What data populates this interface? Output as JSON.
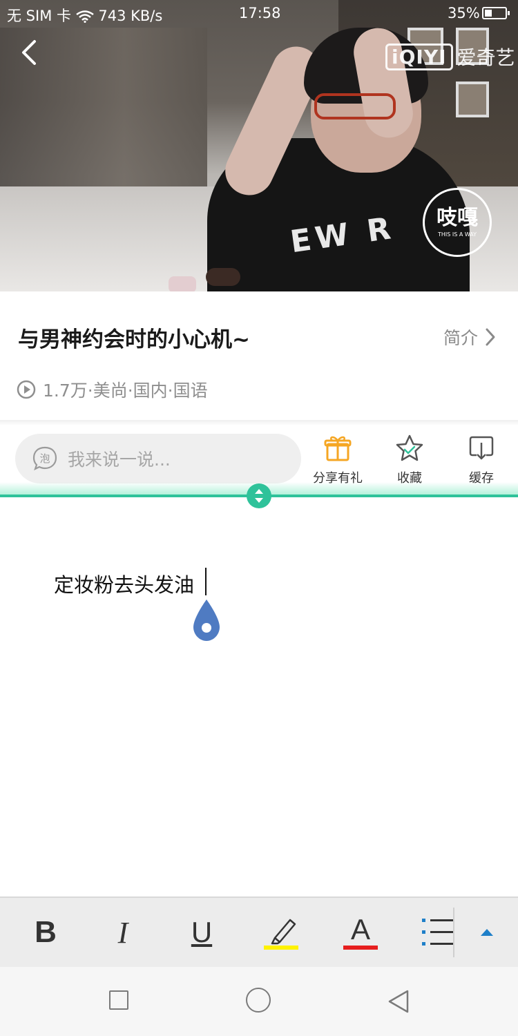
{
  "status_bar": {
    "carrier": "无 SIM 卡",
    "speed": "743 KB/s",
    "time": "17:58",
    "battery": "35%"
  },
  "video": {
    "logo_box": "iQIYI",
    "logo_text": "爱奇艺",
    "channel_badge": "吱嘎",
    "channel_sub": "THIS IS A WAY"
  },
  "info": {
    "title": "与男神约会时的小心机~",
    "intro_label": "简介",
    "meta": "1.7万·美尚·国内·国语"
  },
  "actions": {
    "comment_placeholder": "我来说一说...",
    "bubble_char": "泡",
    "share_gift": "分享有礼",
    "favorite": "收藏",
    "cache": "缓存"
  },
  "note": {
    "text": "定妆粉去头发油"
  },
  "toolbar": {
    "bold": "B",
    "italic": "I",
    "underline": "U",
    "font_color": "A"
  },
  "colors": {
    "accent_green": "#2fc29a",
    "gift_orange": "#f5a623",
    "highlight_yellow": "#fff200",
    "font_red": "#e61e1e",
    "handle_blue": "#4f7bc2"
  }
}
